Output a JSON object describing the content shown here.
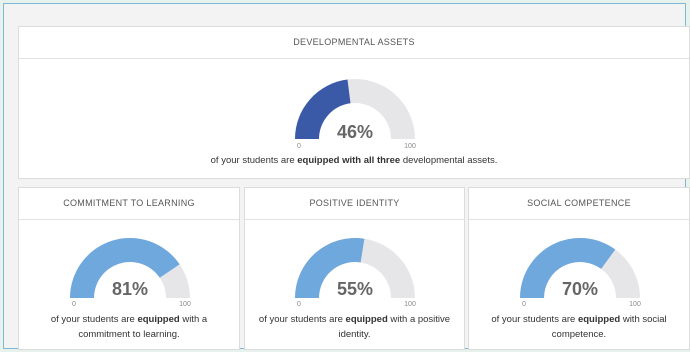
{
  "colors": {
    "main_fill": "#3a5aa8",
    "sub_fill": "#6fa8dc",
    "track": "#e6e6e9"
  },
  "top": {
    "title": "DEVELOPMENTAL ASSETS",
    "percent": 46,
    "percent_label": "46%",
    "min_label": "0",
    "max_label": "100",
    "caption_pre": "of your students are ",
    "caption_bold": "equipped with all three",
    "caption_post": " developmental assets."
  },
  "cards": [
    {
      "title": "COMMITMENT TO LEARNING",
      "percent": 81,
      "percent_label": "81%",
      "min_label": "0",
      "max_label": "100",
      "caption_pre": "of your students are ",
      "caption_bold": "equipped",
      "caption_post": " with a commitment to learning."
    },
    {
      "title": "POSITIVE IDENTITY",
      "percent": 55,
      "percent_label": "55%",
      "min_label": "0",
      "max_label": "100",
      "caption_pre": "of your students are ",
      "caption_bold": "equipped",
      "caption_post": " with a positive identity."
    },
    {
      "title": "SOCIAL COMPETENCE",
      "percent": 70,
      "percent_label": "70%",
      "min_label": "0",
      "max_label": "100",
      "caption_pre": "of your students are ",
      "caption_bold": "equipped",
      "caption_post": " with social competence."
    }
  ]
}
